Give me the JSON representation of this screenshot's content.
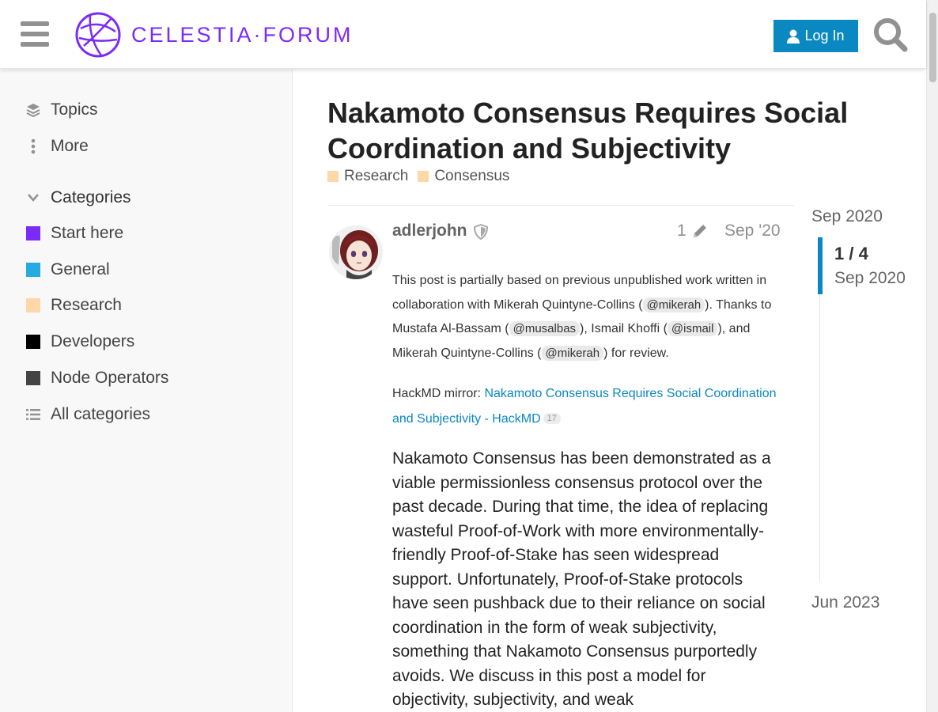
{
  "header": {
    "logo_text": "CELESTIA·FORUM",
    "login_label": "Log In",
    "brand_color": "#7b2bf9",
    "button_color": "#0a88c2"
  },
  "sidebar": {
    "nav": [
      {
        "label": "Topics",
        "icon": "layers-icon"
      },
      {
        "label": "More",
        "icon": "vertical-ellipsis-icon"
      }
    ],
    "categories_heading": "Categories",
    "categories": [
      {
        "label": "Start here",
        "color": "#7b2bf9"
      },
      {
        "label": "General",
        "color": "#25aae1"
      },
      {
        "label": "Research",
        "color": "#ffd7a8"
      },
      {
        "label": "Developers",
        "color": "#000000"
      },
      {
        "label": "Node Operators",
        "color": "#444444"
      }
    ],
    "all_categories": "All categories"
  },
  "topic": {
    "title": "Nakamoto Consensus Requires Social Coordination and Subjectivity",
    "tags": [
      "Research",
      "Consensus"
    ]
  },
  "post": {
    "username": "adlerjohn",
    "edit_count": "1",
    "date": "Sep '20",
    "intro": {
      "t1": "This post is partially based on previous unpublished work written in collaboration with Mikerah Quintyne-Collins (",
      "m1": "@mikerah",
      "t2": "). Thanks to Mustafa Al-Bassam (",
      "m2": "@musalbas",
      "t3": "), Ismail Khoffi (",
      "m3": "@ismail",
      "t4": "), and Mikerah Quintyne-Collins (",
      "m4": "@mikerah",
      "t5": ") for review."
    },
    "mirror_prefix": "HackMD mirror: ",
    "mirror_link": "Nakamoto Consensus Requires Social Coordination and Subjectivity - HackMD",
    "mirror_clicks": "17",
    "body": "Nakamoto Consensus has been demonstrated as a viable permissionless consensus protocol over the past decade. During that time, the idea of replacing wasteful Proof-of-Work with more environmentally-friendly Proof-of-Stake has seen widespread support. Unfortunately, Proof-of-Stake protocols have seen pushback due to their reliance on social coordination in the form of weak subjectivity, something that Nakamoto Consensus purportedly avoids. We discuss in this post a model for objectivity, subjectivity, and weak"
  },
  "timeline": {
    "start": "Sep 2020",
    "position": "1 / 4",
    "position_date": "Sep 2020",
    "end": "Jun 2023"
  }
}
